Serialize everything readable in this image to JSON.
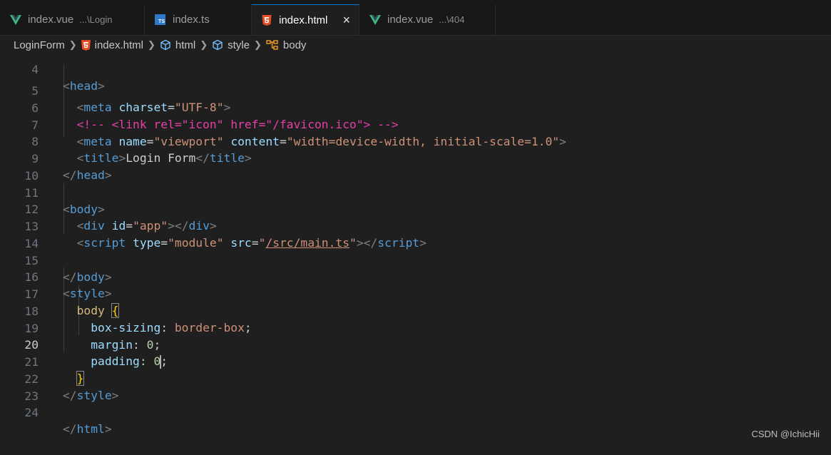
{
  "tabs": [
    {
      "label": "index.vue",
      "desc": "...\\Login",
      "icon": "vue-icon",
      "active": false
    },
    {
      "label": "index.ts",
      "desc": "",
      "icon": "typescript-icon",
      "active": false
    },
    {
      "label": "index.html",
      "desc": "",
      "icon": "html-icon",
      "active": true,
      "close": "×"
    },
    {
      "label": "index.vue",
      "desc": "...\\404",
      "icon": "vue-icon",
      "active": false
    }
  ],
  "breadcrumb": {
    "folder": "LoginForm",
    "file": "index.html",
    "html": "html",
    "style": "style",
    "body": "body"
  },
  "code": {
    "lines": {
      "l4": "4",
      "l5": "5",
      "l6": "6",
      "l7": "7",
      "l8": "8",
      "l9": "9",
      "l10": "10",
      "l11": "11",
      "l12": "12",
      "l13": "13",
      "l14": "14",
      "l15": "15",
      "l16": "16",
      "l17": "17",
      "l18": "18",
      "l19": "19",
      "l20": "20",
      "l21": "21",
      "l22": "22",
      "l23": "23",
      "l24": "24"
    },
    "t": {
      "head": "head",
      "meta": "meta",
      "title": "title",
      "body": "body",
      "div": "div",
      "script": "script",
      "style": "style",
      "html": "html",
      "charset": "charset",
      "name": "name",
      "content": "content",
      "id": "id",
      "type": "type",
      "src": "src",
      "utf8": "\"UTF-8\"",
      "viewport": "\"viewport\"",
      "viewport_content": "\"width=device-width, initial-scale=1.0\"",
      "app": "\"app\"",
      "module": "\"module\"",
      "q": "\"",
      "main_path": "/src/main.ts",
      "title_text": "Login Form",
      "comment": "<!-- <link rel=\"icon\" href=\"/favicon.ico\"> -->",
      "sel_body": "body",
      "p_boxsizing": "box-sizing",
      "v_borderbox": "border-box",
      "p_margin": "margin",
      "p_padding": "padding",
      "zero": "0"
    }
  },
  "watermark": "CSDN @IchicHii",
  "colors": {
    "accent": "#0078d4",
    "tag": "#569cd6",
    "attribute": "#9cdcfe",
    "string": "#ce9178",
    "comment": "#e53fa8"
  }
}
